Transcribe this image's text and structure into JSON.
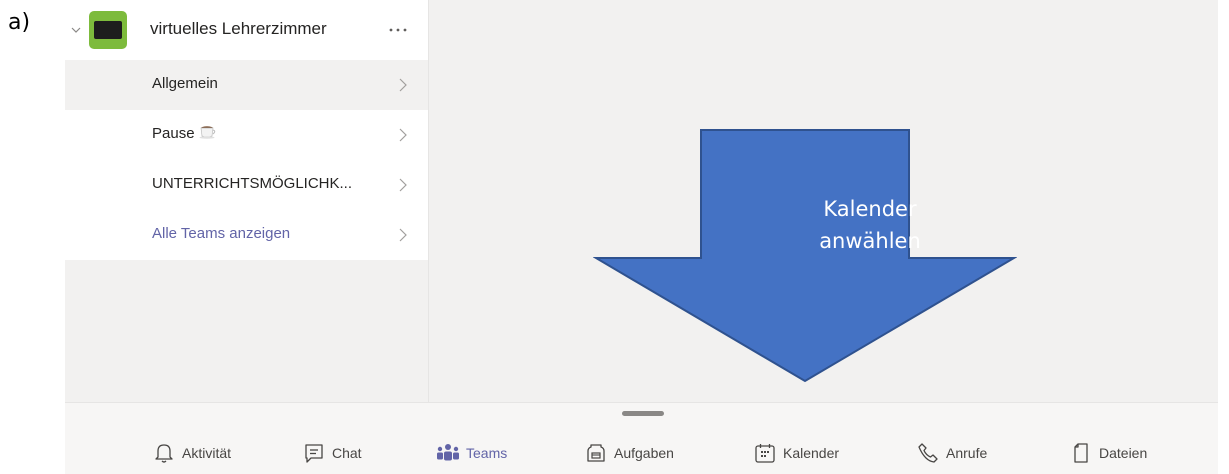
{
  "doc_label": "a)",
  "team": {
    "name": "virtuelles Lehrerzimmer"
  },
  "channels": [
    {
      "label": "Allgemein"
    },
    {
      "label": "Pause"
    },
    {
      "label": "UNTERRICHTSMÖGLICHK..."
    },
    {
      "label": "Alle Teams anzeigen"
    }
  ],
  "annotation": {
    "line1": "Kalender",
    "line2": "anwählen",
    "color": "#4472c4",
    "border_color": "#2f528f"
  },
  "tabs": [
    {
      "label": "Aktivität",
      "icon": "bell-icon"
    },
    {
      "label": "Chat",
      "icon": "chat-icon"
    },
    {
      "label": "Teams",
      "icon": "teams-icon"
    },
    {
      "label": "Aufgaben",
      "icon": "assignments-icon"
    },
    {
      "label": "Kalender",
      "icon": "calendar-icon"
    },
    {
      "label": "Anrufe",
      "icon": "phone-icon"
    },
    {
      "label": "Dateien",
      "icon": "file-icon"
    }
  ],
  "colors": {
    "accent": "#6264a7",
    "background": "#f2f1f0",
    "team_logo": "#7dbb3c"
  }
}
